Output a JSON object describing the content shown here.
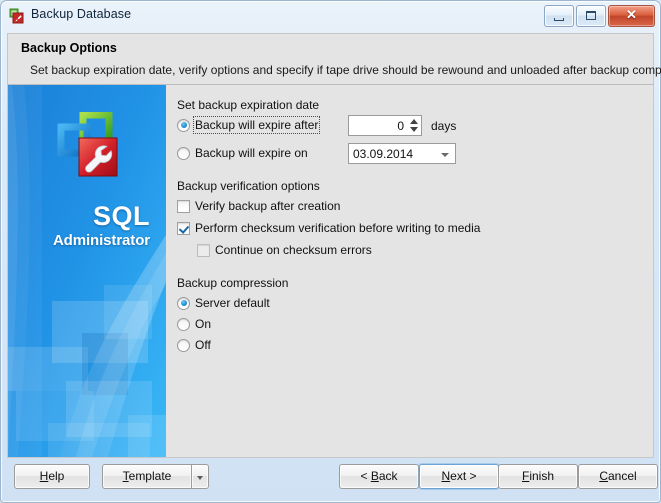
{
  "window": {
    "title": "Backup Database",
    "icon": "database-backup-icon",
    "controls": {
      "minimize": "minimize-icon",
      "maximize": "maximize-icon",
      "close": "✕"
    }
  },
  "header": {
    "title": "Backup Options",
    "description": "Set backup expiration date, verify options and specify if tape drive should be rewound and unloaded after backup completion."
  },
  "sidebar": {
    "brand_primary": "SQL",
    "brand_secondary": "Administrator",
    "logo": "sql-administrator-logo"
  },
  "form": {
    "expiration": {
      "group_label": "Set backup expiration date",
      "option_after": "Backup will expire after",
      "option_after_selected": true,
      "option_on": "Backup will expire on",
      "option_on_selected": false,
      "days_value": "0",
      "days_unit": "days",
      "date_value": "03.09.2014"
    },
    "verification": {
      "group_label": "Backup verification options",
      "verify_after_creation": {
        "label": "Verify backup after creation",
        "checked": false
      },
      "checksum_verification": {
        "label": "Perform checksum verification before writing to media",
        "checked": true
      },
      "continue_on_errors": {
        "label": "Continue on checksum errors",
        "checked": false
      }
    },
    "compression": {
      "group_label": "Backup compression",
      "options": [
        {
          "label": "Server default",
          "selected": true
        },
        {
          "label": "On",
          "selected": false
        },
        {
          "label": "Off",
          "selected": false
        }
      ]
    }
  },
  "footer": {
    "help": "Help",
    "template": "Template",
    "back": "< Back",
    "next": "Next >",
    "finish": "Finish",
    "cancel": "Cancel"
  }
}
